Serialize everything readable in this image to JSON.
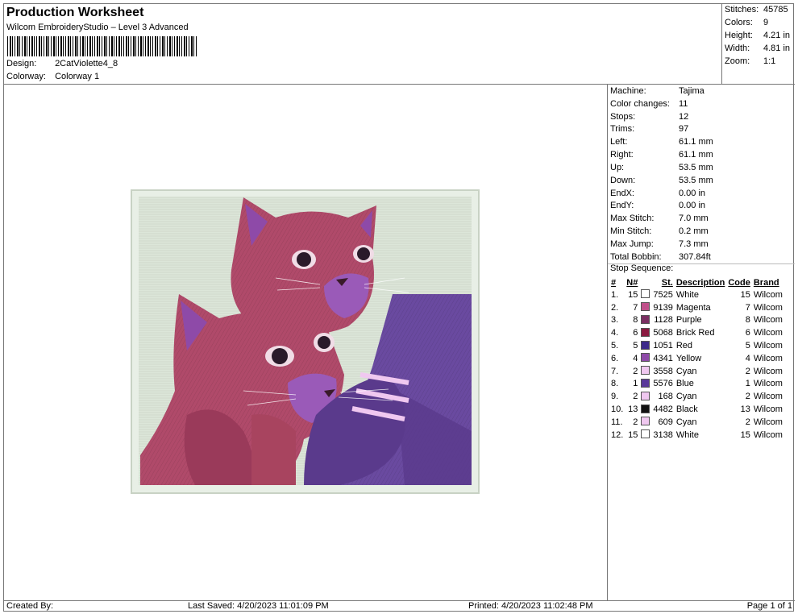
{
  "header": {
    "title": "Production Worksheet",
    "subtitle": "Wilcom EmbroideryStudio – Level 3 Advanced",
    "design_label": "Design:",
    "design_value": "2CatViolette4_8",
    "colorway_label": "Colorway:",
    "colorway_value": "Colorway 1"
  },
  "summary": {
    "stitches_label": "Stitches:",
    "stitches_value": "45785",
    "colors_label": "Colors:",
    "colors_value": "9",
    "height_label": "Height:",
    "height_value": "4.21 in",
    "width_label": "Width:",
    "width_value": "4.81 in",
    "zoom_label": "Zoom:",
    "zoom_value": "1:1"
  },
  "machine_info": [
    {
      "label": "Machine:",
      "value": "Tajima"
    },
    {
      "label": "Color changes:",
      "value": "11"
    },
    {
      "label": "Stops:",
      "value": "12"
    },
    {
      "label": "Trims:",
      "value": "97"
    },
    {
      "label": "Left:",
      "value": "61.1 mm"
    },
    {
      "label": "Right:",
      "value": "61.1 mm"
    },
    {
      "label": "Up:",
      "value": "53.5 mm"
    },
    {
      "label": "Down:",
      "value": "53.5 mm"
    },
    {
      "label": "EndX:",
      "value": "0.00 in"
    },
    {
      "label": "EndY:",
      "value": "0.00 in"
    },
    {
      "label": "Max Stitch:",
      "value": "7.0 mm"
    },
    {
      "label": "Min Stitch:",
      "value": "0.2 mm"
    },
    {
      "label": "Max Jump:",
      "value": "7.3 mm"
    },
    {
      "label": "Total Bobbin:",
      "value": "307.84ft"
    }
  ],
  "stop_sequence": {
    "title": "Stop Sequence:",
    "headers": {
      "index": "#",
      "needle": "N#",
      "stitches": "St.",
      "description": "Description",
      "code": "Code",
      "brand": "Brand"
    },
    "rows": [
      {
        "index": "1.",
        "needle": "15",
        "color": "#ffffff",
        "stitches": "7525",
        "description": "White",
        "code": "15",
        "brand": "Wilcom"
      },
      {
        "index": "2.",
        "needle": "7",
        "color": "#c0508a",
        "stitches": "9139",
        "description": "Magenta",
        "code": "7",
        "brand": "Wilcom"
      },
      {
        "index": "3.",
        "needle": "8",
        "color": "#7a2f62",
        "stitches": "1128",
        "description": "Purple",
        "code": "8",
        "brand": "Wilcom"
      },
      {
        "index": "4.",
        "needle": "6",
        "color": "#8a1a40",
        "stitches": "5068",
        "description": "Brick Red",
        "code": "6",
        "brand": "Wilcom"
      },
      {
        "index": "5.",
        "needle": "5",
        "color": "#3d2a8a",
        "stitches": "1051",
        "description": "Red",
        "code": "5",
        "brand": "Wilcom"
      },
      {
        "index": "6.",
        "needle": "4",
        "color": "#8e4aa8",
        "stitches": "4341",
        "description": "Yellow",
        "code": "4",
        "brand": "Wilcom"
      },
      {
        "index": "7.",
        "needle": "2",
        "color": "#f0c8f0",
        "stitches": "3558",
        "description": "Cyan",
        "code": "2",
        "brand": "Wilcom"
      },
      {
        "index": "8.",
        "needle": "1",
        "color": "#5a3a9a",
        "stitches": "5576",
        "description": "Blue",
        "code": "1",
        "brand": "Wilcom"
      },
      {
        "index": "9.",
        "needle": "2",
        "color": "#f0c8f0",
        "stitches": "168",
        "description": "Cyan",
        "code": "2",
        "brand": "Wilcom"
      },
      {
        "index": "10.",
        "needle": "13",
        "color": "#111111",
        "stitches": "4482",
        "description": "Black",
        "code": "13",
        "brand": "Wilcom"
      },
      {
        "index": "11.",
        "needle": "2",
        "color": "#f0c8f0",
        "stitches": "609",
        "description": "Cyan",
        "code": "2",
        "brand": "Wilcom"
      },
      {
        "index": "12.",
        "needle": "15",
        "color": "#ffffff",
        "stitches": "3138",
        "description": "White",
        "code": "15",
        "brand": "Wilcom"
      }
    ]
  },
  "footer": {
    "created_by": "Created By:",
    "last_saved": "Last Saved: 4/20/2023 11:01:09 PM",
    "printed": "Printed: 4/20/2023 11:02:48 PM",
    "page": "Page 1 of 1"
  }
}
